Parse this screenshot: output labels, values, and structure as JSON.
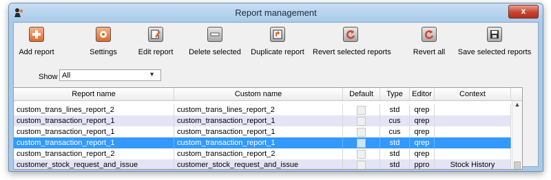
{
  "window": {
    "title": "Report management",
    "close_label": "x"
  },
  "toolbar": {
    "buttons": [
      {
        "label": "Add report",
        "icon": "plus-icon"
      },
      {
        "label": "Settings",
        "icon": "gear-icon"
      },
      {
        "label": "Edit report",
        "icon": "edit-icon"
      },
      {
        "label": "Delete selected",
        "icon": "minus-icon"
      },
      {
        "label": "Duplicate report",
        "icon": "duplicate-icon"
      },
      {
        "label": "Revert selected reports",
        "icon": "revert-icon"
      },
      {
        "label": "Revert all",
        "icon": "revert-all-icon"
      },
      {
        "label": "Save selected reports",
        "icon": "save-icon"
      }
    ]
  },
  "filter": {
    "show_label": "Show",
    "show_value": "All"
  },
  "table": {
    "columns": [
      "Report name",
      "Custom name",
      "Default",
      "Type",
      "Editor",
      "Context"
    ],
    "rows": [
      {
        "name": "custom_trans_lines_report_2",
        "custom": "custom_trans_lines_report_2",
        "default": false,
        "type": "std",
        "editor": "qrep",
        "context": ""
      },
      {
        "name": "custom_transaction_report_1",
        "custom": "custom_transaction_report_1",
        "default": false,
        "type": "cus",
        "editor": "qrep",
        "context": ""
      },
      {
        "name": "custom_transaction_report_1",
        "custom": "custom_transaction_report_1",
        "default": false,
        "type": "cus",
        "editor": "qrep",
        "context": ""
      },
      {
        "name": "custom_transaction_report_1",
        "custom": "custom_transaction_report_1",
        "default": false,
        "type": "std",
        "editor": "qrep",
        "context": "",
        "selected": true
      },
      {
        "name": "custom_transaction_report_2",
        "custom": "custom_transaction_report_2",
        "default": false,
        "type": "std",
        "editor": "qrep",
        "context": ""
      },
      {
        "name": "customer_stock_request_and_issue",
        "custom": "customer_stock_request_and_issue",
        "default": false,
        "type": "std",
        "editor": "ppro",
        "context": "Stock History"
      }
    ]
  },
  "colors": {
    "selection": "#3399ff",
    "alt_row": "#e4e4f6",
    "title_bar": "#a9cbea"
  }
}
